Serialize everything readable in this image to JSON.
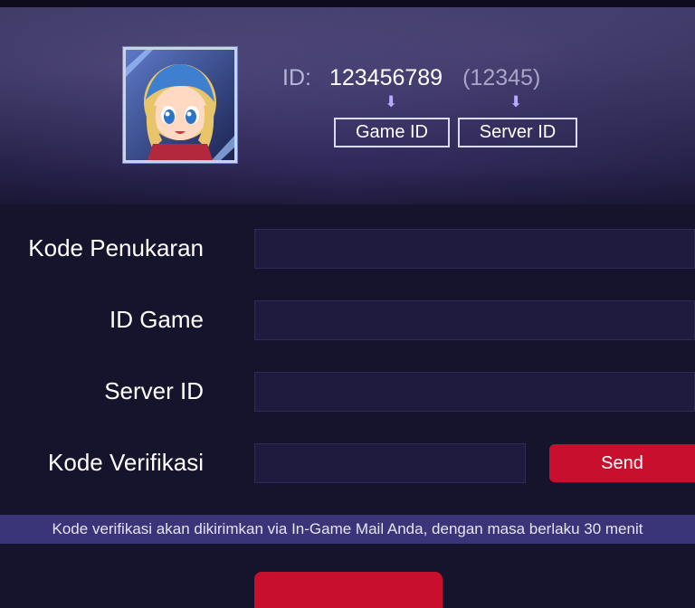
{
  "header": {
    "id_label": "ID:",
    "game_id_value": "123456789",
    "server_id_value": "(12345)",
    "game_id_caption": "Game ID",
    "server_id_caption": "Server ID",
    "arrow_glyph": "⬇"
  },
  "form": {
    "redeem_code_label": "Kode Penukaran",
    "game_id_label": "ID Game",
    "server_id_label": "Server ID",
    "verification_label": "Kode Verifikasi",
    "redeem_code_value": "",
    "game_id_value": "",
    "server_id_value": "",
    "verification_value": "",
    "send_label": "Send"
  },
  "notice": {
    "text": "Kode verifikasi akan dikirimkan via In-Game Mail Anda, dengan masa berlaku 30 menit"
  },
  "colors": {
    "accent_red": "#c8102e",
    "background": "#16132c",
    "notice_bar": "#3a3478",
    "arrow": "#b8a9ff"
  }
}
